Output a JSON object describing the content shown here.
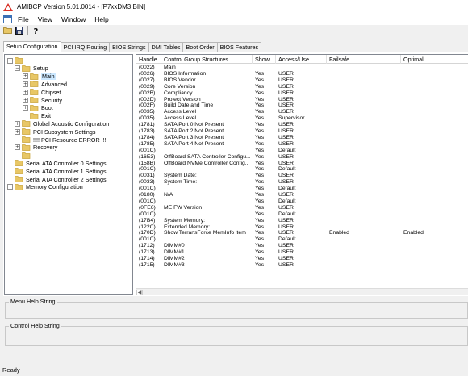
{
  "window": {
    "title": "AMIBCP Version 5.01.0014 - [P7xxDM3.BIN]"
  },
  "menu": {
    "items": [
      "File",
      "View",
      "Window",
      "Help"
    ]
  },
  "toolbar": {
    "buttons": [
      "open-folder-icon",
      "save-disk-icon",
      "help-question-icon"
    ]
  },
  "tabs": [
    "Setup Configuration",
    "PCI IRQ Routing",
    "BIOS Strings",
    "DMI Tables",
    "Boot Order",
    "BIOS Features"
  ],
  "active_tab": 0,
  "tree": [
    {
      "label": "",
      "level": 0,
      "expander": "-",
      "folder": true
    },
    {
      "label": "Setup",
      "level": 1,
      "expander": "-",
      "folder": true
    },
    {
      "label": "Main",
      "level": 2,
      "expander": "+",
      "folder": true,
      "selected": true
    },
    {
      "label": "Advanced",
      "level": 2,
      "expander": "+",
      "folder": true
    },
    {
      "label": "Chipset",
      "level": 2,
      "expander": "+",
      "folder": true
    },
    {
      "label": "Security",
      "level": 2,
      "expander": "+",
      "folder": true
    },
    {
      "label": "Boot",
      "level": 2,
      "expander": "+",
      "folder": true
    },
    {
      "label": "Exit",
      "level": 2,
      "expander": "",
      "folder": true
    },
    {
      "label": "Global Acoustic Configuration",
      "level": 1,
      "expander": "+",
      "folder": true
    },
    {
      "label": "PCI Subsystem Settings",
      "level": 1,
      "expander": "+",
      "folder": true
    },
    {
      "label": "!!!! PCI Resource ERROR !!!!",
      "level": 1,
      "expander": "",
      "folder": true
    },
    {
      "label": "Recovery",
      "level": 1,
      "expander": "+",
      "folder": true
    },
    {
      "label": "",
      "level": 1,
      "expander": "",
      "folder": true
    },
    {
      "label": "Serial ATA Controller 0 Settings",
      "level": 0,
      "expander": "",
      "folder": true
    },
    {
      "label": "Serial ATA Controller 1 Settings",
      "level": 0,
      "expander": "",
      "folder": true
    },
    {
      "label": "Serial ATA Controller 2 Settings",
      "level": 0,
      "expander": "",
      "folder": true
    },
    {
      "label": "Memory Configuration",
      "level": 0,
      "expander": "+",
      "folder": true
    }
  ],
  "grid": {
    "columns": [
      "Handle",
      "Control Group Structures",
      "Show",
      "Access/Use",
      "Failsafe",
      "Optimal"
    ],
    "rows": [
      [
        "(0022)",
        "Main",
        "",
        "",
        "",
        ""
      ],
      [
        "(0026)",
        "BIOS Information",
        "Yes",
        "USER",
        "",
        ""
      ],
      [
        "(0027)",
        "BIOS Vendor",
        "Yes",
        "USER",
        "",
        ""
      ],
      [
        "(0029)",
        "Core Version",
        "Yes",
        "USER",
        "",
        ""
      ],
      [
        "(002B)",
        "Compliancy",
        "Yes",
        "USER",
        "",
        ""
      ],
      [
        "(002D)",
        "Project Version",
        "Yes",
        "USER",
        "",
        ""
      ],
      [
        "(002F)",
        "Build Date and Time",
        "Yes",
        "USER",
        "",
        ""
      ],
      [
        "(0035)",
        "Access Level",
        "Yes",
        "USER",
        "",
        ""
      ],
      [
        "(0035)",
        "Access Level",
        "Yes",
        "Supervisor",
        "",
        ""
      ],
      [
        "(1781)",
        "SATA Port 0  Not Present",
        "Yes",
        "USER",
        "",
        ""
      ],
      [
        "(1783)",
        "SATA Port 2  Not Present",
        "Yes",
        "USER",
        "",
        ""
      ],
      [
        "(1784)",
        "SATA Port 3  Not Present",
        "Yes",
        "USER",
        "",
        ""
      ],
      [
        "(1785)",
        "SATA Port 4  Not Present",
        "Yes",
        "USER",
        "",
        ""
      ],
      [
        "(001C)",
        "",
        "Yes",
        "Default",
        "",
        ""
      ],
      [
        "(16E3)",
        "OffBoard SATA Controller Configu...",
        "Yes",
        "USER",
        "",
        ""
      ],
      [
        "(158B)",
        "OffBoard NVMe Controller Config...",
        "Yes",
        "USER",
        "",
        ""
      ],
      [
        "(001C)",
        "",
        "Yes",
        "Default",
        "",
        ""
      ],
      [
        "(0031)",
        "System Date:",
        "Yes",
        "USER",
        "",
        ""
      ],
      [
        "(0033)",
        "System Time:",
        "Yes",
        "USER",
        "",
        ""
      ],
      [
        "(001C)",
        "",
        "Yes",
        "Default",
        "",
        ""
      ],
      [
        "(0180)",
        "N/A",
        "Yes",
        "USER",
        "",
        ""
      ],
      [
        "(001C)",
        "",
        "Yes",
        "Default",
        "",
        ""
      ],
      [
        "(0FE6)",
        "ME FW Version",
        "Yes",
        "USER",
        "",
        ""
      ],
      [
        "(001C)",
        "",
        "Yes",
        "Default",
        "",
        ""
      ],
      [
        "(17B4)",
        "System Memory:",
        "Yes",
        "USER",
        "",
        ""
      ],
      [
        "(122C)",
        "Extended Memory:",
        "Yes",
        "USER",
        "",
        ""
      ],
      [
        "(170D)",
        "Show TerransForce MemInfo item",
        "Yes",
        "USER",
        "Enabled",
        "Enabled"
      ],
      [
        "(001C)",
        "",
        "Yes",
        "Default",
        "",
        ""
      ],
      [
        "(1712)",
        "DIMM#0",
        "Yes",
        "USER",
        "",
        ""
      ],
      [
        "(1713)",
        "DIMM#1",
        "Yes",
        "USER",
        "",
        ""
      ],
      [
        "(1714)",
        "DIMM#2",
        "Yes",
        "USER",
        "",
        ""
      ],
      [
        "(1715)",
        "DIMM#3",
        "Yes",
        "USER",
        "",
        ""
      ]
    ]
  },
  "help": {
    "menu_label": "Menu Help String",
    "control_label": "Control Help String"
  },
  "status": {
    "text": "Ready"
  },
  "colors": {
    "folder": "#e8c766",
    "folder_dark": "#c9a43a",
    "selected": "#cce8ff",
    "app_icon": "#d93025"
  }
}
